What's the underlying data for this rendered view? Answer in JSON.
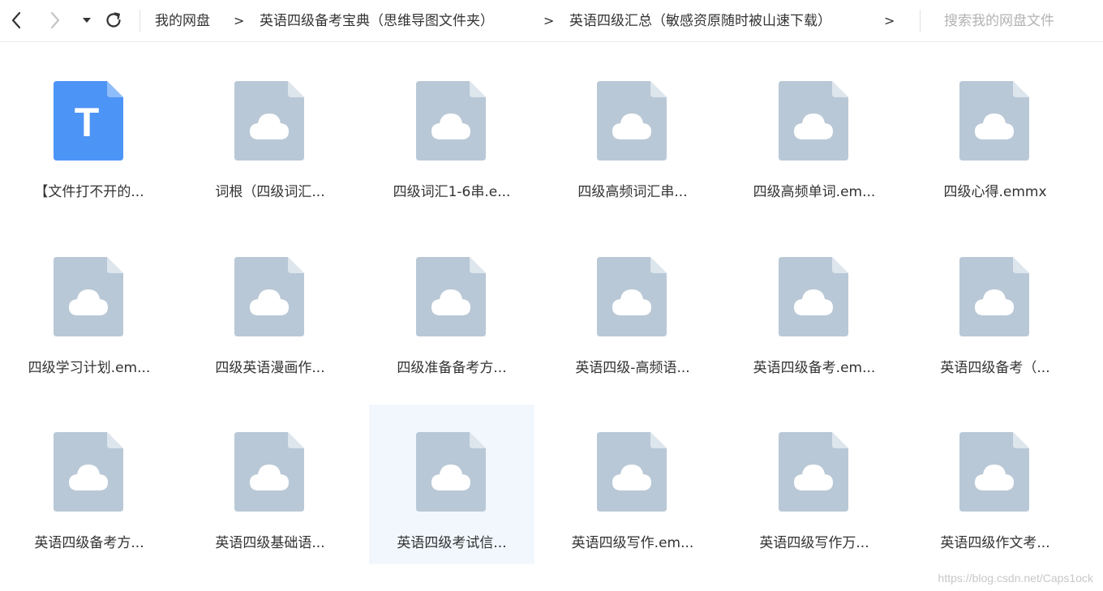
{
  "nav": {
    "back_icon": "chevron-left-icon",
    "forward_icon": "chevron-right-icon",
    "dropdown_icon": "caret-down-icon",
    "refresh_icon": "refresh-icon"
  },
  "breadcrumb": {
    "items": [
      "我的网盘",
      "英语四级备考宝典（思维导图文件夹）",
      "英语四级汇总（敏感资原随时被山速下载）"
    ],
    "separator": ">"
  },
  "search": {
    "placeholder": "搜索我的网盘文件"
  },
  "colors": {
    "doc_icon": "#b9c8d6",
    "text_icon": "#4d94f7",
    "selected_bg": "#f1f7fd"
  },
  "files": [
    {
      "name": "【文件打不开的...",
      "icon": "text-file-icon",
      "icon_letter": "T"
    },
    {
      "name": "词根（四级词汇...",
      "icon": "cloud-file-icon"
    },
    {
      "name": "四级词汇1-6串.e...",
      "icon": "cloud-file-icon"
    },
    {
      "name": "四级高频词汇串...",
      "icon": "cloud-file-icon"
    },
    {
      "name": "四级高频单词.em...",
      "icon": "cloud-file-icon"
    },
    {
      "name": "四级心得.emmx",
      "icon": "cloud-file-icon"
    },
    {
      "name": "四级学习计划.em...",
      "icon": "cloud-file-icon"
    },
    {
      "name": "四级英语漫画作...",
      "icon": "cloud-file-icon"
    },
    {
      "name": "四级准备备考方...",
      "icon": "cloud-file-icon"
    },
    {
      "name": "英语四级-高频语...",
      "icon": "cloud-file-icon"
    },
    {
      "name": "英语四级备考.em...",
      "icon": "cloud-file-icon"
    },
    {
      "name": "英语四级备考（...",
      "icon": "cloud-file-icon"
    },
    {
      "name": "英语四级备考方...",
      "icon": "cloud-file-icon"
    },
    {
      "name": "英语四级基础语...",
      "icon": "cloud-file-icon"
    },
    {
      "name": "英语四级考试信...",
      "icon": "cloud-file-icon",
      "selected": true
    },
    {
      "name": "英语四级写作.em...",
      "icon": "cloud-file-icon"
    },
    {
      "name": "英语四级写作万...",
      "icon": "cloud-file-icon"
    },
    {
      "name": "英语四级作文考...",
      "icon": "cloud-file-icon"
    }
  ],
  "watermark": "https://blog.csdn.net/Caps1ock"
}
